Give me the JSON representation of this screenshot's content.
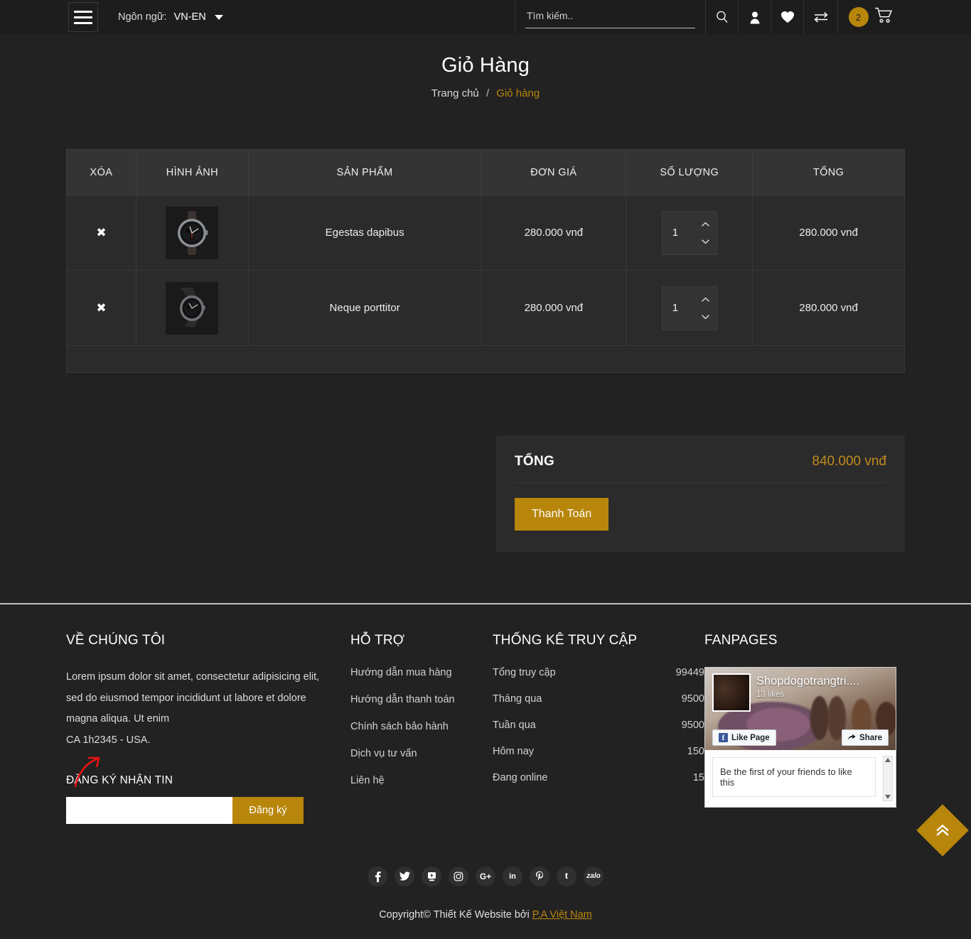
{
  "header": {
    "menu_icon": "hamburger-icon",
    "language_label": "Ngôn ngữ:",
    "language_value": "VN-EN",
    "search_placeholder": "Tìm kiếm..",
    "search_value": "",
    "icons": [
      "search-icon",
      "user-icon",
      "heart-icon",
      "compare-icon",
      "cart-icon"
    ],
    "cart_count": "2"
  },
  "page": {
    "title": "Giỏ Hàng",
    "breadcrumb_home": "Trang chủ",
    "breadcrumb_sep": "/",
    "breadcrumb_current": "Giỏ hàng"
  },
  "cart": {
    "columns": [
      "XÓA",
      "HÌNH ẢNH",
      "SẢN PHẨM",
      "ĐƠN GIÁ",
      "SỐ LƯỢNG",
      "TỔNG"
    ],
    "remove_glyph": "✖",
    "rows": [
      {
        "product": "Egestas dapibus",
        "price": "280.000 vnđ",
        "qty": "1",
        "total": "280.000 vnđ",
        "image": "watch-chronograph-thumb"
      },
      {
        "product": "Neque porttitor",
        "price": "280.000 vnđ",
        "qty": "1",
        "total": "280.000 vnđ",
        "image": "watch-angled-thumb"
      }
    ]
  },
  "totals": {
    "label": "TỔNG",
    "value": "840.000 vnđ",
    "checkout_label": "Thanh Toán"
  },
  "footer": {
    "about": {
      "title": "VỀ CHÚNG TÔI",
      "text": "Lorem ipsum dolor sit amet, consectetur adipisicing elit, sed do eiusmod tempor incididunt ut labore et dolore magna aliqua. Ut enim",
      "address": "CA 1h2345 - USA.",
      "newsletter_title": "ĐĂNG KÝ NHẬN TIN",
      "newsletter_value": "",
      "newsletter_placeholder": "",
      "newsletter_button": "Đăng ký"
    },
    "support": {
      "title": "HỖ TRỢ",
      "links": [
        "Hướng dẫn mua hàng",
        "Hướng dẫn thanh toán",
        "Chính sách bảo hành",
        "Dịch vụ tư vấn",
        "Liên hệ"
      ]
    },
    "stats": {
      "title": "THỐNG KÊ TRUY CẬP",
      "rows": [
        {
          "label": "Tổng truy cập",
          "value": "99449"
        },
        {
          "label": "Tháng qua",
          "value": "9500"
        },
        {
          "label": "Tuần qua",
          "value": "9500"
        },
        {
          "label": "Hôm nay",
          "value": "150"
        },
        {
          "label": "Đang online",
          "value": "15"
        }
      ]
    },
    "fanpages": {
      "title": "FANPAGES",
      "page_name": "Shopdogotrangtri....",
      "likes": "13 likes",
      "like_button": "Like Page",
      "share_button": "Share",
      "note": "Be the first of your friends to like this"
    },
    "socials": [
      "facebook-icon",
      "twitter-icon",
      "youtube-icon",
      "instagram-icon",
      "google-plus-icon",
      "linkedin-icon",
      "pinterest-icon",
      "tumblr-icon",
      "zalo-icon"
    ],
    "zalo_label": "zalo",
    "gplus_label": "G+",
    "linkedin_label": "in",
    "tumblr_label": "t",
    "copyright_text": "Copyright© Thiết Kế Website bởi",
    "copyright_brand": "P.A Việt Nam"
  },
  "back_to_top": "back-to-top-icon",
  "colors": {
    "accent": "#b8860b",
    "page_bg": "#222222",
    "panel_bg": "#2b2b2b",
    "header_bg": "#1d1d1d",
    "annotation": "#e81313"
  }
}
